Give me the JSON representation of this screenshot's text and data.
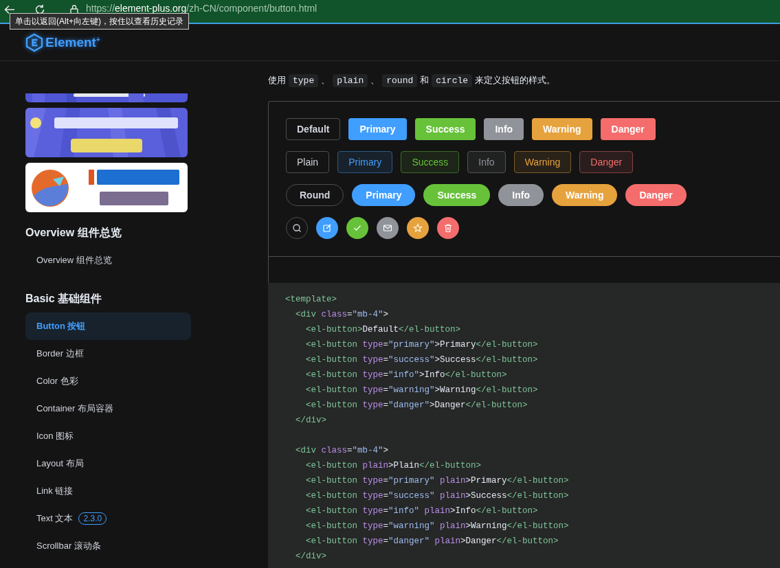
{
  "browser": {
    "url": {
      "scheme": "https://",
      "host": "element-plus.org",
      "path": "/zh-CN/component/button.html"
    },
    "tooltip": "单击以返回(Alt+向左键)，按住以查看历史记录"
  },
  "header": {
    "logo": "Element$^{+}$"
  },
  "sidebar": {
    "groups": [
      {
        "title": "Overview 组件总览",
        "items": [
          {
            "label": "Overview 组件总览",
            "selected": false
          }
        ]
      },
      {
        "title": "Basic 基础组件",
        "items": [
          {
            "label": "Button 按钮",
            "selected": true
          },
          {
            "label": "Border 边框",
            "selected": false
          },
          {
            "label": "Color 色彩",
            "selected": false
          },
          {
            "label": "Container 布局容器",
            "selected": false
          },
          {
            "label": "Icon 图标",
            "selected": false
          },
          {
            "label": "Layout 布局",
            "selected": false
          },
          {
            "label": "Link 链接",
            "selected": false
          },
          {
            "label": "Text 文本",
            "badge": "2.3.0",
            "selected": false
          },
          {
            "label": "Scrollbar 滚动条",
            "selected": false
          }
        ]
      }
    ]
  },
  "main": {
    "description": [
      {
        "kind": "text",
        "text": "使用"
      },
      {
        "kind": "code",
        "text": "type"
      },
      {
        "kind": "text",
        "text": "、"
      },
      {
        "kind": "code",
        "text": "plain"
      },
      {
        "kind": "text",
        "text": "、"
      },
      {
        "kind": "code",
        "text": "round"
      },
      {
        "kind": "text",
        "text": "和"
      },
      {
        "kind": "code",
        "text": "circle"
      },
      {
        "kind": "text",
        "text": "来定义按钮的样式。"
      }
    ],
    "button_rows": [
      {
        "kind": "normal",
        "buttons": [
          {
            "kind": "default",
            "label": "Default"
          },
          {
            "kind": "primary",
            "label": "Primary"
          },
          {
            "kind": "success",
            "label": "Success"
          },
          {
            "kind": "info",
            "label": "Info"
          },
          {
            "kind": "warning",
            "label": "Warning"
          },
          {
            "kind": "danger",
            "label": "Danger"
          }
        ]
      },
      {
        "kind": "plain",
        "buttons": [
          {
            "kind": "default",
            "label": "Plain"
          },
          {
            "kind": "primary",
            "label": "Primary"
          },
          {
            "kind": "success",
            "label": "Success"
          },
          {
            "kind": "info",
            "label": "Info"
          },
          {
            "kind": "warning",
            "label": "Warning"
          },
          {
            "kind": "danger",
            "label": "Danger"
          }
        ]
      },
      {
        "kind": "round",
        "buttons": [
          {
            "kind": "default",
            "label": "Round"
          },
          {
            "kind": "primary",
            "label": "Primary"
          },
          {
            "kind": "success",
            "label": "Success"
          },
          {
            "kind": "info",
            "label": "Info"
          },
          {
            "kind": "warning",
            "label": "Warning"
          },
          {
            "kind": "danger",
            "label": "Danger"
          }
        ]
      },
      {
        "kind": "circle",
        "buttons": [
          {
            "kind": "default"
          },
          {
            "kind": "primary"
          },
          {
            "kind": "success"
          },
          {
            "kind": "info"
          },
          {
            "kind": "warning"
          },
          {
            "kind": "danger"
          }
        ]
      }
    ],
    "code_lines": [
      {
        "kind": "code",
        "tokens": [
          {
            "kind": "tag",
            "text": "<template>"
          }
        ]
      },
      {
        "kind": "code",
        "tokens": [
          {
            "kind": "tag",
            "text": "  <div"
          },
          {
            "kind": "attr",
            "text": " class"
          },
          {
            "kind": "plain",
            "text": "="
          },
          {
            "kind": "str",
            "text": "\"mb-4\""
          },
          {
            "kind": "plain",
            "text": ">"
          }
        ]
      },
      {
        "kind": "code",
        "tokens": [
          {
            "kind": "tag",
            "text": "    <el-button>"
          },
          {
            "kind": "plain",
            "text": "Default"
          },
          {
            "kind": "tag",
            "text": "</el-button>"
          }
        ]
      },
      {
        "kind": "code",
        "tokens": [
          {
            "kind": "tag",
            "text": "    <el-button"
          },
          {
            "kind": "attr",
            "text": " type"
          },
          {
            "kind": "plain",
            "text": "="
          },
          {
            "kind": "str",
            "text": "\"primary\""
          },
          {
            "kind": "plain",
            "text": ">Primary"
          },
          {
            "kind": "tag",
            "text": "</el-button>"
          }
        ]
      },
      {
        "kind": "code",
        "tokens": [
          {
            "kind": "tag",
            "text": "    <el-button"
          },
          {
            "kind": "attr",
            "text": " type"
          },
          {
            "kind": "plain",
            "text": "="
          },
          {
            "kind": "str",
            "text": "\"success\""
          },
          {
            "kind": "plain",
            "text": ">Success"
          },
          {
            "kind": "tag",
            "text": "</el-button>"
          }
        ]
      },
      {
        "kind": "code",
        "tokens": [
          {
            "kind": "tag",
            "text": "    <el-button"
          },
          {
            "kind": "attr",
            "text": " type"
          },
          {
            "kind": "plain",
            "text": "="
          },
          {
            "kind": "str",
            "text": "\"info\""
          },
          {
            "kind": "plain",
            "text": ">Info"
          },
          {
            "kind": "tag",
            "text": "</el-button>"
          }
        ]
      },
      {
        "kind": "code",
        "tokens": [
          {
            "kind": "tag",
            "text": "    <el-button"
          },
          {
            "kind": "attr",
            "text": " type"
          },
          {
            "kind": "plain",
            "text": "="
          },
          {
            "kind": "str",
            "text": "\"warning\""
          },
          {
            "kind": "plain",
            "text": ">Warning"
          },
          {
            "kind": "tag",
            "text": "</el-button>"
          }
        ]
      },
      {
        "kind": "code",
        "tokens": [
          {
            "kind": "tag",
            "text": "    <el-button"
          },
          {
            "kind": "attr",
            "text": " type"
          },
          {
            "kind": "plain",
            "text": "="
          },
          {
            "kind": "str",
            "text": "\"danger\""
          },
          {
            "kind": "plain",
            "text": ">Danger"
          },
          {
            "kind": "tag",
            "text": "</el-button>"
          }
        ]
      },
      {
        "kind": "code",
        "tokens": [
          {
            "kind": "tag",
            "text": "  </div>"
          }
        ]
      },
      {
        "kind": "blank"
      },
      {
        "kind": "code",
        "tokens": [
          {
            "kind": "tag",
            "text": "  <div"
          },
          {
            "kind": "attr",
            "text": " class"
          },
          {
            "kind": "plain",
            "text": "="
          },
          {
            "kind": "str",
            "text": "\"mb-4\""
          },
          {
            "kind": "plain",
            "text": ">"
          }
        ]
      },
      {
        "kind": "code",
        "tokens": [
          {
            "kind": "tag",
            "text": "    <el-button"
          },
          {
            "kind": "attr",
            "text": " plain"
          },
          {
            "kind": "plain",
            "text": ">Plain"
          },
          {
            "kind": "tag",
            "text": "</el-button>"
          }
        ]
      },
      {
        "kind": "code",
        "tokens": [
          {
            "kind": "tag",
            "text": "    <el-button"
          },
          {
            "kind": "attr",
            "text": " type"
          },
          {
            "kind": "plain",
            "text": "="
          },
          {
            "kind": "str",
            "text": "\"primary\""
          },
          {
            "kind": "attr",
            "text": " plain"
          },
          {
            "kind": "plain",
            "text": ">Primary"
          },
          {
            "kind": "tag",
            "text": "</el-button>"
          }
        ]
      },
      {
        "kind": "code",
        "tokens": [
          {
            "kind": "tag",
            "text": "    <el-button"
          },
          {
            "kind": "attr",
            "text": " type"
          },
          {
            "kind": "plain",
            "text": "="
          },
          {
            "kind": "str",
            "text": "\"success\""
          },
          {
            "kind": "attr",
            "text": " plain"
          },
          {
            "kind": "plain",
            "text": ">Success"
          },
          {
            "kind": "tag",
            "text": "</el-button>"
          }
        ]
      },
      {
        "kind": "code",
        "tokens": [
          {
            "kind": "tag",
            "text": "    <el-button"
          },
          {
            "kind": "attr",
            "text": " type"
          },
          {
            "kind": "plain",
            "text": "="
          },
          {
            "kind": "str",
            "text": "\"info\""
          },
          {
            "kind": "attr",
            "text": " plain"
          },
          {
            "kind": "plain",
            "text": ">Info"
          },
          {
            "kind": "tag",
            "text": "</el-button>"
          }
        ]
      },
      {
        "kind": "code",
        "tokens": [
          {
            "kind": "tag",
            "text": "    <el-button"
          },
          {
            "kind": "attr",
            "text": " type"
          },
          {
            "kind": "plain",
            "text": "="
          },
          {
            "kind": "str",
            "text": "\"warning\""
          },
          {
            "kind": "attr",
            "text": " plain"
          },
          {
            "kind": "plain",
            "text": ">Warning"
          },
          {
            "kind": "tag",
            "text": "</el-button>"
          }
        ]
      },
      {
        "kind": "code",
        "tokens": [
          {
            "kind": "tag",
            "text": "    <el-button"
          },
          {
            "kind": "attr",
            "text": " type"
          },
          {
            "kind": "plain",
            "text": "="
          },
          {
            "kind": "str",
            "text": "\"danger\""
          },
          {
            "kind": "attr",
            "text": " plain"
          },
          {
            "kind": "plain",
            "text": ">Danger"
          },
          {
            "kind": "tag",
            "text": "</el-button>"
          }
        ]
      },
      {
        "kind": "code",
        "tokens": [
          {
            "kind": "tag",
            "text": "  </div>"
          }
        ]
      }
    ]
  }
}
